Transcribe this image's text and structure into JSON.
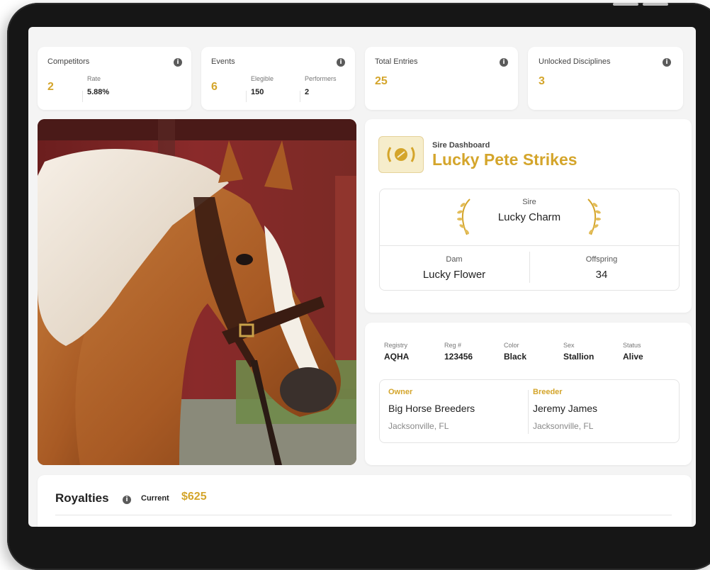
{
  "stats": {
    "competitors": {
      "label": "Competitors",
      "value": "2",
      "sub": [
        {
          "label": "Rate",
          "value": "5.88%"
        }
      ]
    },
    "events": {
      "label": "Events",
      "value": "6",
      "sub": [
        {
          "label": "Elegible",
          "value": "150"
        },
        {
          "label": "Performers",
          "value": "2"
        }
      ]
    },
    "total_entries": {
      "label": "Total Entries",
      "value": "25"
    },
    "unlocked_disciplines": {
      "label": "Unlocked Disciplines",
      "value": "3"
    }
  },
  "dashboard": {
    "label": "Sire Dashboard",
    "horse_name": "Lucky Pete Strikes",
    "sire_label": "Sire",
    "sire_value": "Lucky Charm",
    "dam_label": "Dam",
    "dam_value": "Lucky Flower",
    "offspring_label": "Offspring",
    "offspring_value": "34"
  },
  "details": [
    {
      "label": "Registry",
      "value": "AQHA"
    },
    {
      "label": "Reg #",
      "value": "123456"
    },
    {
      "label": "Color",
      "value": "Black"
    },
    {
      "label": "Sex",
      "value": "Stallion"
    },
    {
      "label": "Status",
      "value": "Alive"
    }
  ],
  "owner": {
    "label": "Owner",
    "name": "Big Horse Breeders",
    "city": "Jacksonville, FL"
  },
  "breeder": {
    "label": "Breeder",
    "name": "Jeremy James",
    "city": "Jacksonville, FL"
  },
  "royalties": {
    "title": "Royalties",
    "current_label": "Current",
    "current_value": "$625"
  },
  "icons": {
    "info": "info-icon",
    "badge": "laurel-badge-icon",
    "laurel": "laurel-icon"
  },
  "colors": {
    "accent": "#d4a52b",
    "background": "#f4f4f4",
    "frame": "#161616"
  }
}
